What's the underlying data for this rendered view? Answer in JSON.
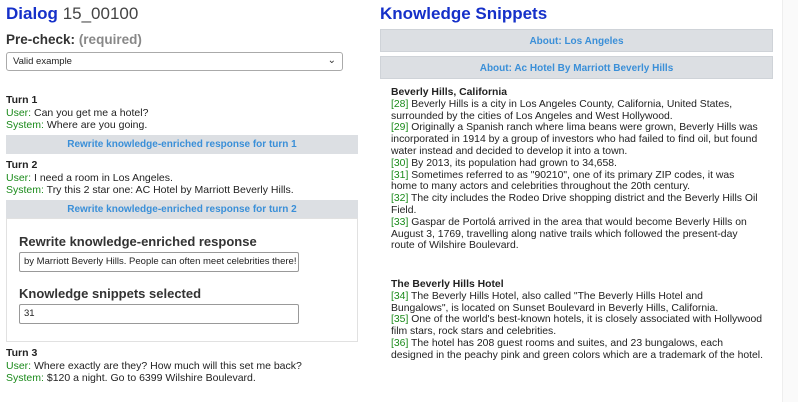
{
  "dialog": {
    "label": "Dialog",
    "id": "15_00100"
  },
  "precheck": {
    "label": "Pre-check:",
    "required": "(required)",
    "selected": "Valid example"
  },
  "turns": [
    {
      "header": "Turn 1",
      "user_label": "User:",
      "user": " Can you get me a hotel?",
      "system_label": "System:",
      "system": " Where are you going."
    },
    {
      "header": "Turn 2",
      "user_label": "User:",
      "user": " I need a room in Los Angeles.",
      "system_label": "System:",
      "system": " Try this 2 star one: AC Hotel by Marriott Beverly Hills."
    },
    {
      "header": "Turn 3",
      "user_label": "User:",
      "user": " Where exactly are they? How much will this set me back?",
      "system_label": "System:",
      "system": " $120 a night. Go to 6399 Wilshire Boulevard."
    }
  ],
  "rewrite_buttons": [
    "Rewrite knowledge-enriched response for turn 1",
    "Rewrite knowledge-enriched response for turn 2"
  ],
  "rewrite_panel": {
    "heading": "Rewrite knowledge-enriched response",
    "response_value": "by Marriott Beverly Hills. People can often meet celebrities there!",
    "snippets_heading": "Knowledge snippets selected",
    "snippets_value": "31"
  },
  "knowledge": {
    "title": "Knowledge Snippets",
    "about": [
      "About: Los Angeles",
      "About: Ac Hotel By Marriott Beverly Hills"
    ],
    "groups": [
      {
        "heading": "Beverly Hills, California",
        "snippets": [
          {
            "id": "[28]",
            "text": " Beverly Hills is a city in Los Angeles County, California, United States, surrounded by the cities of Los Angeles and West Hollywood."
          },
          {
            "id": "[29]",
            "text": " Originally a Spanish ranch where lima beans were grown, Beverly Hills was incorporated in 1914 by a group of investors who had failed to find oil, but found water instead and decided to develop it into a town."
          },
          {
            "id": "[30]",
            "text": " By 2013, its population had grown to 34,658."
          },
          {
            "id": "[31]",
            "text": " Sometimes referred to as \"90210\", one of its primary ZIP codes, it was home to many actors and celebrities throughout the 20th century."
          },
          {
            "id": "[32]",
            "text": " The city includes the Rodeo Drive shopping district and the Beverly Hills Oil Field."
          },
          {
            "id": "[33]",
            "text": " Gaspar de Portolá arrived in the area that would become Beverly Hills on August 3, 1769, travelling along native trails which followed the present-day route of Wilshire Boulevard."
          }
        ]
      },
      {
        "heading": "The Beverly Hills Hotel",
        "snippets": [
          {
            "id": "[34]",
            "text": " The Beverly Hills Hotel, also called \"The Beverly Hills Hotel and Bungalows\", is located on Sunset Boulevard in Beverly Hills, California."
          },
          {
            "id": "[35]",
            "text": " One of the world's best-known hotels, it is closely associated with Hollywood film stars, rock stars and celebrities."
          },
          {
            "id": "[36]",
            "text": " The hotel has 208 guest rooms and suites, and 23 bungalows, each designed in the peachy pink and green colors which are a trademark of the hotel."
          }
        ]
      }
    ]
  }
}
